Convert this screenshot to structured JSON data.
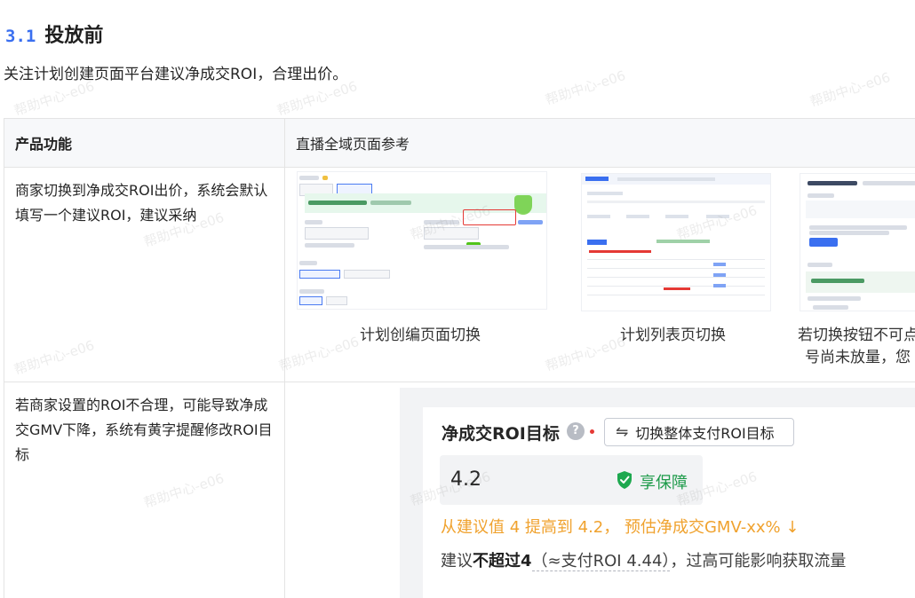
{
  "section": {
    "number": "3.1",
    "title": "投放前"
  },
  "intro": "关注计划创建页面平台建议净成交ROI，合理出价。",
  "watermark": "帮助中心-e06",
  "table": {
    "headers": [
      "产品功能",
      "直播全域页面参考"
    ],
    "rows": [
      {
        "feature": "商家切换到净成交ROI出价，系统会默认填写一个建议ROI，建议采纳",
        "captions": [
          "计划创编页面切换",
          "计划列表页切换",
          "若切换按钮不可点",
          "号尚未放量，您"
        ],
        "shot1": {
          "mode_label": "投放方式",
          "option_a": "放量投放",
          "option_b": "提速本地操",
          "banner": "全域ROI稳定 成本更可控",
          "budget_label": "日预算",
          "budget_value": "300",
          "roi_label": "整体支付ROI目标",
          "roi_value": "4.36",
          "guard": "享保障",
          "switch_text": "切换净成交ROI目标",
          "time_label": "投放日期",
          "time_a": "从今日起长期投放",
          "time_b": "设置开始和结束日期",
          "smart_label": "智能优惠券",
          "smart_a": "启用",
          "smart_b": "不启用"
        },
        "shot3": {
          "title": "直播全域推广",
          "btn": "立即体验",
          "roi_banner": "全域ROI稳定 成本更可控",
          "field": "请输入数值"
        }
      },
      {
        "feature": "若商家设置的ROI不合理，可能导致净成交GMV下降，系统有黄字提醒修改ROI目标",
        "image": {
          "title": "净成交ROI目标",
          "help_icon": "?",
          "switch_button": "切换整体支付ROI目标",
          "roi_value": "4.2",
          "guarantee": "享保障",
          "warning": "从建议值 4 提高到 4.2， 预估净成交GMV-xx% ↓",
          "suggest_prefix": "建议",
          "suggest_bold": "不超过4",
          "suggest_paren": "（≈支付ROI 4.44）",
          "suggest_suffix": "，过高可能影响获取流量"
        }
      }
    ]
  }
}
